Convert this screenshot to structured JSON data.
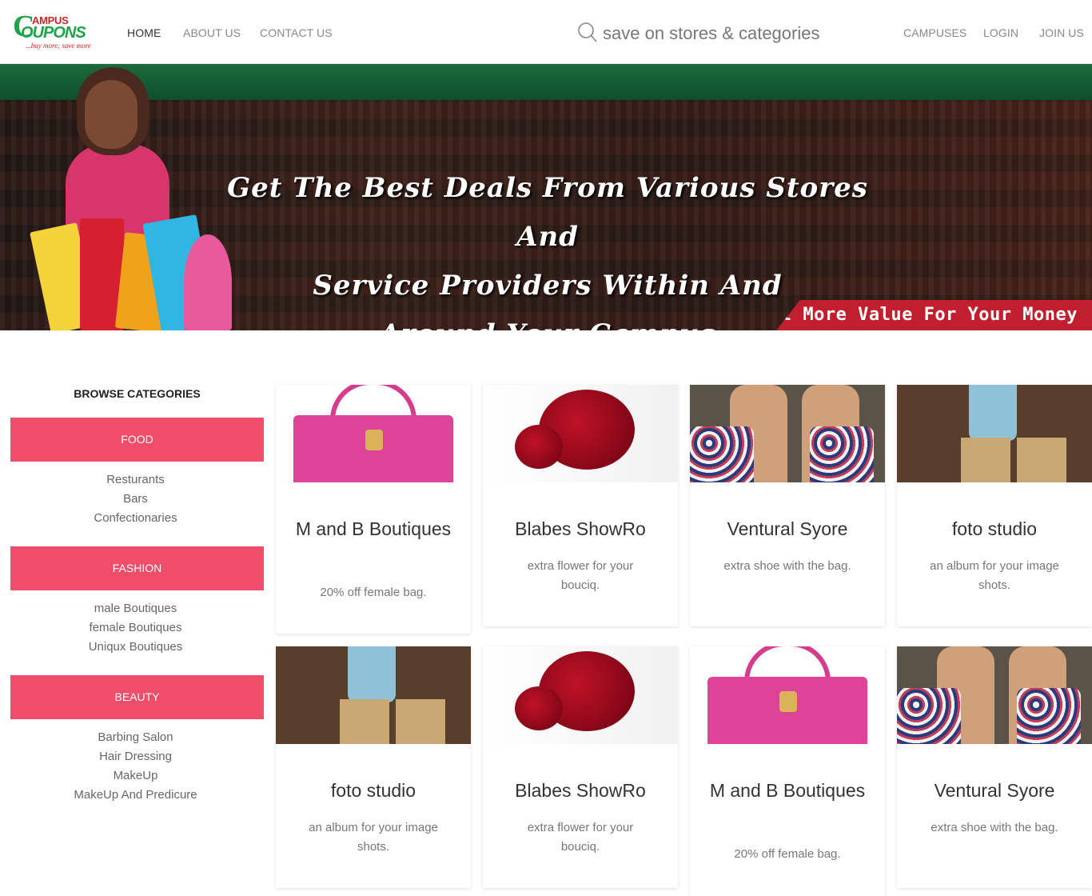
{
  "logo": {
    "line1": "AMPUS",
    "line2": "OUPONS",
    "letter": "C",
    "tagline": "...buy more; save more"
  },
  "nav": {
    "left": [
      "HOME",
      "ABOUT US",
      "CONTACT US"
    ],
    "right": [
      "CAMPUSES",
      "LOGIN",
      "JOIN US"
    ],
    "active": "HOME"
  },
  "search": {
    "placeholder": "save on stores & categories",
    "value": ""
  },
  "hero": {
    "tagline_lines": [
      "Get The Best Deals From Various Stores And",
      "Service Providers Within And",
      "Around Your Campus"
    ],
    "ribbon": "Get More Value For Your Money",
    "colors": {
      "band": "#1c6a3d",
      "ribbon": "#c21f2e"
    }
  },
  "sidebar": {
    "title": "BROWSE CATEGORIES",
    "accent": "#ef4d6a",
    "categories": [
      {
        "name": "FOOD",
        "items": [
          "Resturants",
          "Bars",
          "Confectionaries"
        ]
      },
      {
        "name": "FASHION",
        "items": [
          "male Boutiques",
          "female Boutiques",
          "Uniqux Boutiques"
        ]
      },
      {
        "name": "BEAUTY",
        "items": [
          "Barbing Salon",
          "Hair Dressing",
          "MakeUp",
          "MakeUp And Predicure"
        ]
      }
    ]
  },
  "deals": [
    {
      "title": "M and B Boutiques",
      "desc": "20% off female bag.",
      "image": "pink-handbag"
    },
    {
      "title": "Blabes ShowRo",
      "desc": "extra flower for your bouciq.",
      "image": "red-rose"
    },
    {
      "title": "Ventural Syore",
      "desc": "extra shoe with the bag.",
      "image": "floral-heels"
    },
    {
      "title": "foto studio",
      "desc": "an album for your image shots.",
      "image": "fashion-model"
    },
    {
      "title": "foto studio",
      "desc": "an album for your image shots.",
      "image": "fashion-model"
    },
    {
      "title": "Blabes ShowRo",
      "desc": "extra flower for your bouciq.",
      "image": "red-rose"
    },
    {
      "title": "M and B Boutiques",
      "desc": "20% off female bag.",
      "image": "pink-handbag"
    },
    {
      "title": "Ventural Syore",
      "desc": "extra shoe with the bag.",
      "image": "floral-heels"
    }
  ]
}
